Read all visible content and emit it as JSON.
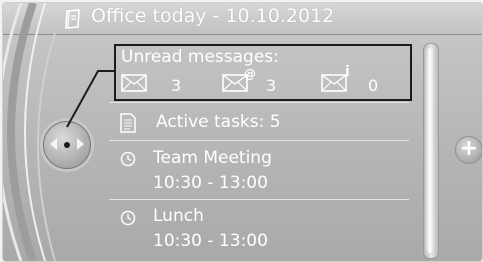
{
  "header": {
    "title": "Office today - 10.10.2012"
  },
  "unread": {
    "label": "Unread messages:",
    "items": [
      {
        "icon": "envelope-icon",
        "count": "3"
      },
      {
        "icon": "envelope-email-icon",
        "superscript": "@",
        "count": "3"
      },
      {
        "icon": "envelope-info-icon",
        "superscript": "i",
        "count": "0"
      }
    ]
  },
  "tasks": {
    "icon": "document-icon",
    "label": "Active tasks: 5"
  },
  "appointments": [
    {
      "icon": "clock-icon",
      "title": "Team Meeting",
      "time": "10:30 - 13:00"
    },
    {
      "icon": "clock-icon",
      "title": "Lunch",
      "time": "10:30 - 13:00"
    }
  ],
  "controls": {
    "plus_label": "+"
  },
  "colors": {
    "text": "#ffffff",
    "background": "#b8b8b8",
    "highlight_border": "#1c1c1c"
  }
}
